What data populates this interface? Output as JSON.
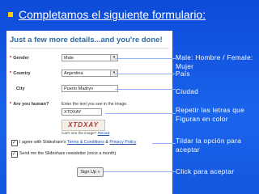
{
  "slide": {
    "title": "Completamos el siguiente formulario:"
  },
  "form": {
    "heading": "Just a few more details...and you're done!",
    "gender": {
      "label": "Gender",
      "value": "Male"
    },
    "country": {
      "label": "Country",
      "value": "Argentina"
    },
    "city": {
      "label": "City",
      "value": "Puerto Madryn"
    },
    "human": {
      "label": "Are you human?",
      "instruction": "Enter the text you see in the image.",
      "input_value": "XTDXAY",
      "captcha_text": "XTDXAY",
      "cant_read_prefix": "Can't see the image?",
      "cant_read_link": "Reload"
    },
    "agree": {
      "checked": "✓",
      "prefix": "I agree with Slideshare's",
      "terms_link": "Terms & Conditions",
      "and": "&",
      "privacy_link": "Privacy Policy"
    },
    "newsletter": {
      "checked": "✓",
      "text": "Send me the Slideshare newsletter (once a month)"
    },
    "signup_button": "Sign Up »"
  },
  "annotations": {
    "gender_line1": "Male: Hombre / Female:",
    "gender_line2": "Mujer",
    "country": "País",
    "city": "Ciudad",
    "captcha_line1": "Repetir las letras que",
    "captcha_line2": "Figuran en color",
    "agree_line1": "Tildar la opción para",
    "agree_line2": "aceptar",
    "signup": "Click para aceptar"
  },
  "colors": {
    "slide_bg": "#1a64ec",
    "title_bullet": "#ffcc00",
    "form_heading": "#2c6aa4"
  }
}
